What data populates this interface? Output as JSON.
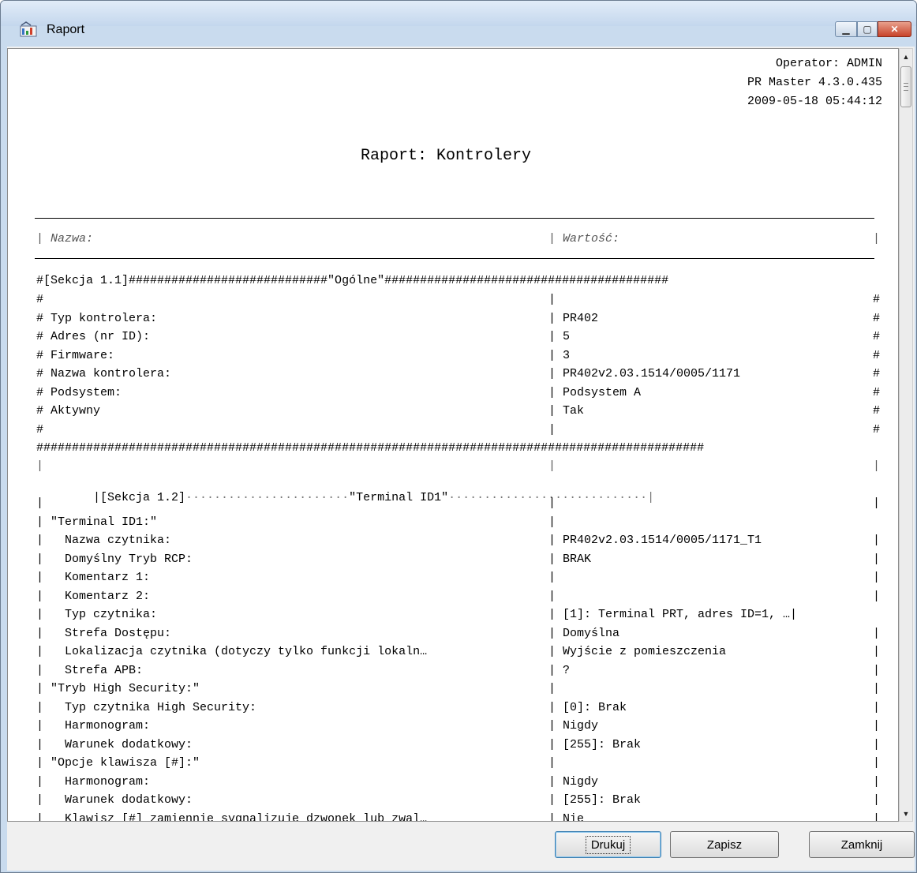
{
  "window": {
    "title": "Raport"
  },
  "report": {
    "header": [
      "Operator: ADMIN",
      "PR Master 4.3.0.435",
      "2009-05-18 05:44:12"
    ],
    "title": "Raport: Kontrolery",
    "col_name": "| Nazwa:",
    "col_value": "| Wartość:",
    "col_end": "|",
    "sec1_header": "#[Sekcja 1.1]############################\"Ogólne\"########################################",
    "sec1_rows": [
      {
        "label": "#",
        "value": "|",
        "end": "#"
      },
      {
        "label": "# Typ kontrolera:",
        "value": "| PR402",
        "end": "#"
      },
      {
        "label": "# Adres (nr ID):",
        "value": "| 5",
        "end": "#"
      },
      {
        "label": "# Firmware:",
        "value": "| 3",
        "end": "#"
      },
      {
        "label": "# Nazwa kontrolera:",
        "value": "| PR402v2.03.1514/0005/1171",
        "end": "#"
      },
      {
        "label": "# Podsystem:",
        "value": "| Podsystem A",
        "end": "#"
      },
      {
        "label": "# Aktywny",
        "value": "| Tak",
        "end": "#"
      },
      {
        "label": "#",
        "value": "|",
        "end": "#"
      }
    ],
    "sec1_footer": "##############################################################################################",
    "sec2_pre": {
      "label": "|",
      "value": "|",
      "end": "|"
    },
    "sec2_header_label": "|[Sekcja 1.2]",
    "sec2_header_dots1": "·······················",
    "sec2_header_name": "\"Terminal ID1\"",
    "sec2_header_dots2": "····························|",
    "sec2_rows": [
      {
        "label": "|",
        "value": "|",
        "end": "|"
      },
      {
        "label": "| \"Terminal ID1:\"",
        "value": "|",
        "end": ""
      },
      {
        "label": "|   Nazwa czytnika:",
        "value": "| PR402v2.03.1514/0005/1171_T1",
        "end": "|"
      },
      {
        "label": "|   Domyślny Tryb RCP:",
        "value": "| BRAK",
        "end": "|"
      },
      {
        "label": "|   Komentarz 1:",
        "value": "|",
        "end": "|"
      },
      {
        "label": "|   Komentarz 2:",
        "value": "|",
        "end": "|"
      },
      {
        "label": "|   Typ czytnika:",
        "value": "| [1]: Terminal PRT, adres ID=1, …|",
        "end": ""
      },
      {
        "label": "|   Strefa Dostępu:",
        "value": "| Domyślna",
        "end": "|"
      },
      {
        "label": "|   Lokalizacja czytnika (dotyczy tylko funkcji lokaln…",
        "value": "| Wyjście z pomieszczenia",
        "end": "|"
      },
      {
        "label": "|   Strefa APB:",
        "value": "| ?",
        "end": "|"
      },
      {
        "label": "| \"Tryb High Security:\"",
        "value": "|",
        "end": "|"
      },
      {
        "label": "|   Typ czytnika High Security:",
        "value": "| [0]: Brak",
        "end": "|"
      },
      {
        "label": "|   Harmonogram:",
        "value": "| Nigdy",
        "end": "|"
      },
      {
        "label": "|   Warunek dodatkowy:",
        "value": "| [255]: Brak",
        "end": "|"
      },
      {
        "label": "| \"Opcje klawisza [#]:\"",
        "value": "|",
        "end": "|"
      },
      {
        "label": "|   Harmonogram:",
        "value": "| Nigdy",
        "end": "|"
      },
      {
        "label": "|   Warunek dodatkowy:",
        "value": "| [255]: Brak",
        "end": "|"
      },
      {
        "label": "|   Klawisz [#] zamiennie sygnalizuje dzwonek lub zwal…",
        "value": "| Nie",
        "end": "|"
      }
    ]
  },
  "buttons": {
    "print": "Drukuj",
    "save": "Zapisz",
    "close": "Zamknij"
  }
}
